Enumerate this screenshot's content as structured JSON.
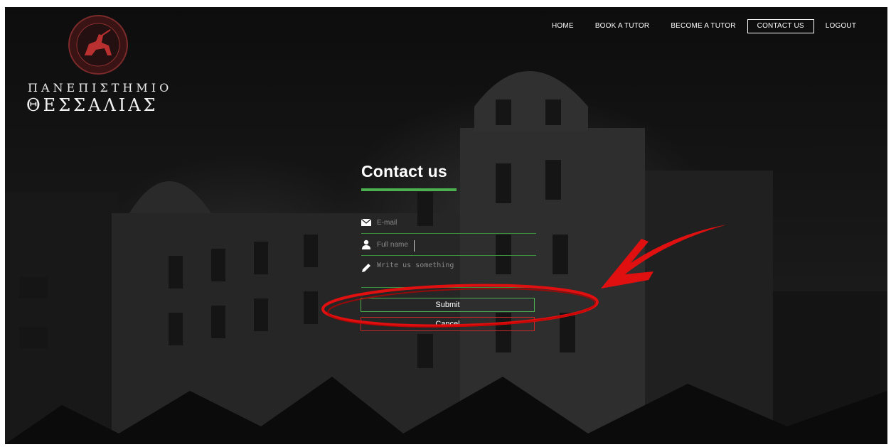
{
  "logo": {
    "line1": "ΠΑΝΕΠΙΣΤΗΜΙΟ",
    "line2": "ΘΕΣΣΑΛΙΑΣ",
    "icon": "university-seal-icon"
  },
  "nav": {
    "items": [
      {
        "label": "HOME",
        "active": false
      },
      {
        "label": "BOOK A TUTOR",
        "active": false
      },
      {
        "label": "BECOME A TUTOR",
        "active": false
      },
      {
        "label": "CONTACT US",
        "active": true
      },
      {
        "label": "LOGOUT",
        "active": false
      }
    ]
  },
  "form": {
    "title": "Contact us",
    "email": {
      "value": "",
      "placeholder": "E-mail",
      "icon": "envelope-icon"
    },
    "fullname": {
      "value": "",
      "placeholder": "Full name",
      "icon": "user-icon"
    },
    "message": {
      "value": "",
      "placeholder": "Write us something",
      "icon": "pencil-icon"
    },
    "submit_label": "Submit",
    "cancel_label": "Cancel"
  },
  "colors": {
    "accent_green": "#4caf50",
    "cancel_red": "#c62828",
    "annotation_red": "#e01010",
    "background": "#121212"
  }
}
